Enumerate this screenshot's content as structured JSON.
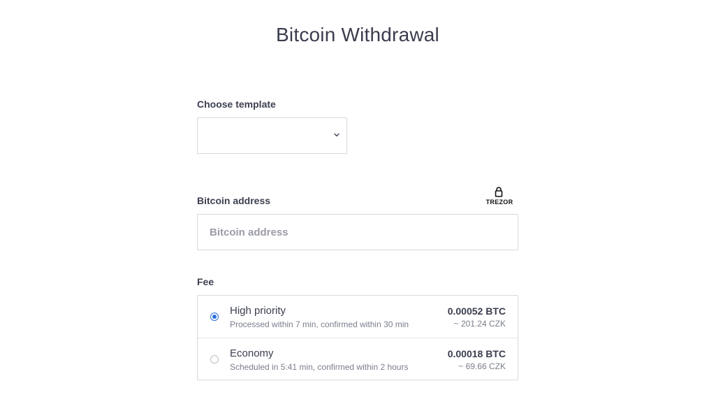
{
  "page": {
    "title": "Bitcoin Withdrawal"
  },
  "template": {
    "label": "Choose template",
    "selected": "",
    "icon": "chevron-down-icon"
  },
  "address": {
    "label": "Bitcoin address",
    "value": "",
    "placeholder": "Bitcoin address",
    "trezor_label": "TREZOR",
    "trezor_icon": "lock-icon"
  },
  "fee": {
    "label": "Fee",
    "options": [
      {
        "name": "High priority",
        "description": "Processed within 7 min, confirmed within 30 min",
        "btc": "0.00052 BTC",
        "czk": "~ 201.24 CZK",
        "selected": true
      },
      {
        "name": "Economy",
        "description": "Scheduled in 5:41 min, confirmed within 2 hours",
        "btc": "0.00018 BTC",
        "czk": "~ 69.66 CZK",
        "selected": false
      }
    ]
  },
  "colors": {
    "accent": "#2b6fe0",
    "text": "#3c3f4f",
    "muted": "#7b7e8c",
    "border": "#d6d8de"
  }
}
